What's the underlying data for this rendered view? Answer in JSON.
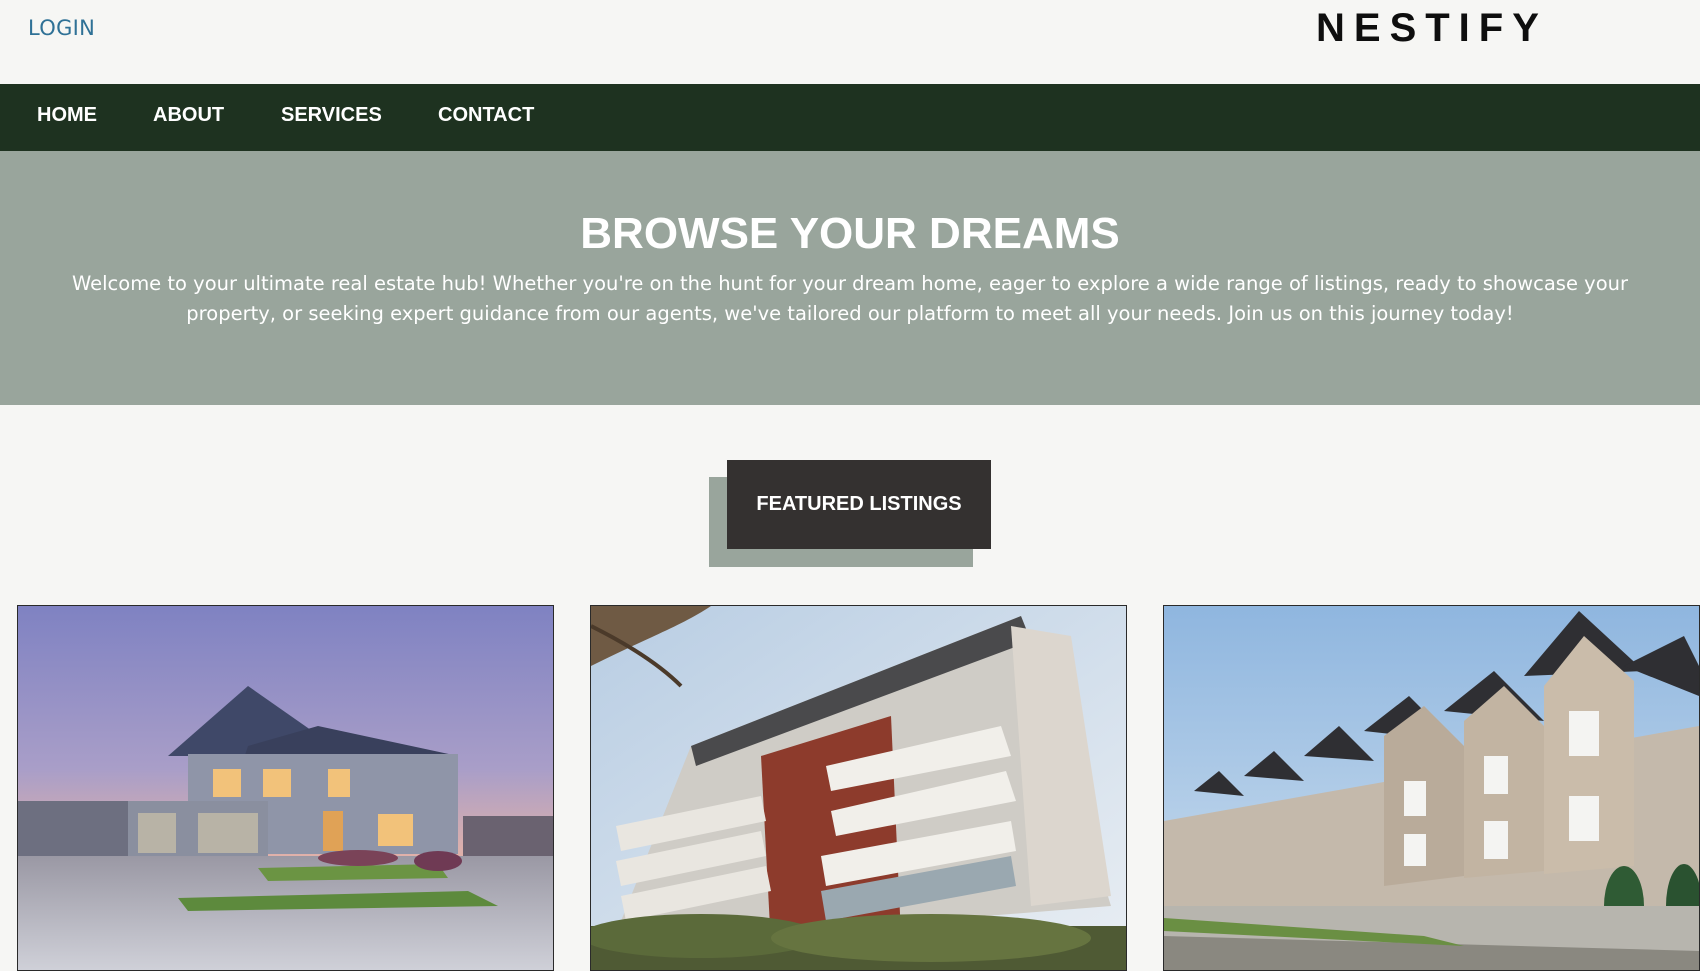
{
  "header": {
    "login_label": "LOGIN",
    "brand": "NESTIFY"
  },
  "nav": {
    "items": [
      {
        "label": "HOME"
      },
      {
        "label": "ABOUT"
      },
      {
        "label": "SERVICES"
      },
      {
        "label": "CONTACT"
      }
    ]
  },
  "hero": {
    "title": "BROWSE YOUR DREAMS",
    "text": "Welcome to your ultimate real estate hub! Whether you're on the hunt for your dream home, eager to explore a wide range of listings, ready to showcase your property, or seeking expert guidance from our agents, we've tailored our platform to meet all your needs. Join us on this journey today!"
  },
  "featured": {
    "label": "FEATURED LISTINGS"
  },
  "listings": [
    {
      "image": "suburban-house-at-dusk-photo"
    },
    {
      "image": "modern-apartment-building-photo"
    },
    {
      "image": "townhouse-row-photo"
    }
  ],
  "colors": {
    "nav_bg": "#1e3220",
    "hero_bg": "#99a59c",
    "button_bg": "#343130",
    "login": "#2f7196"
  }
}
